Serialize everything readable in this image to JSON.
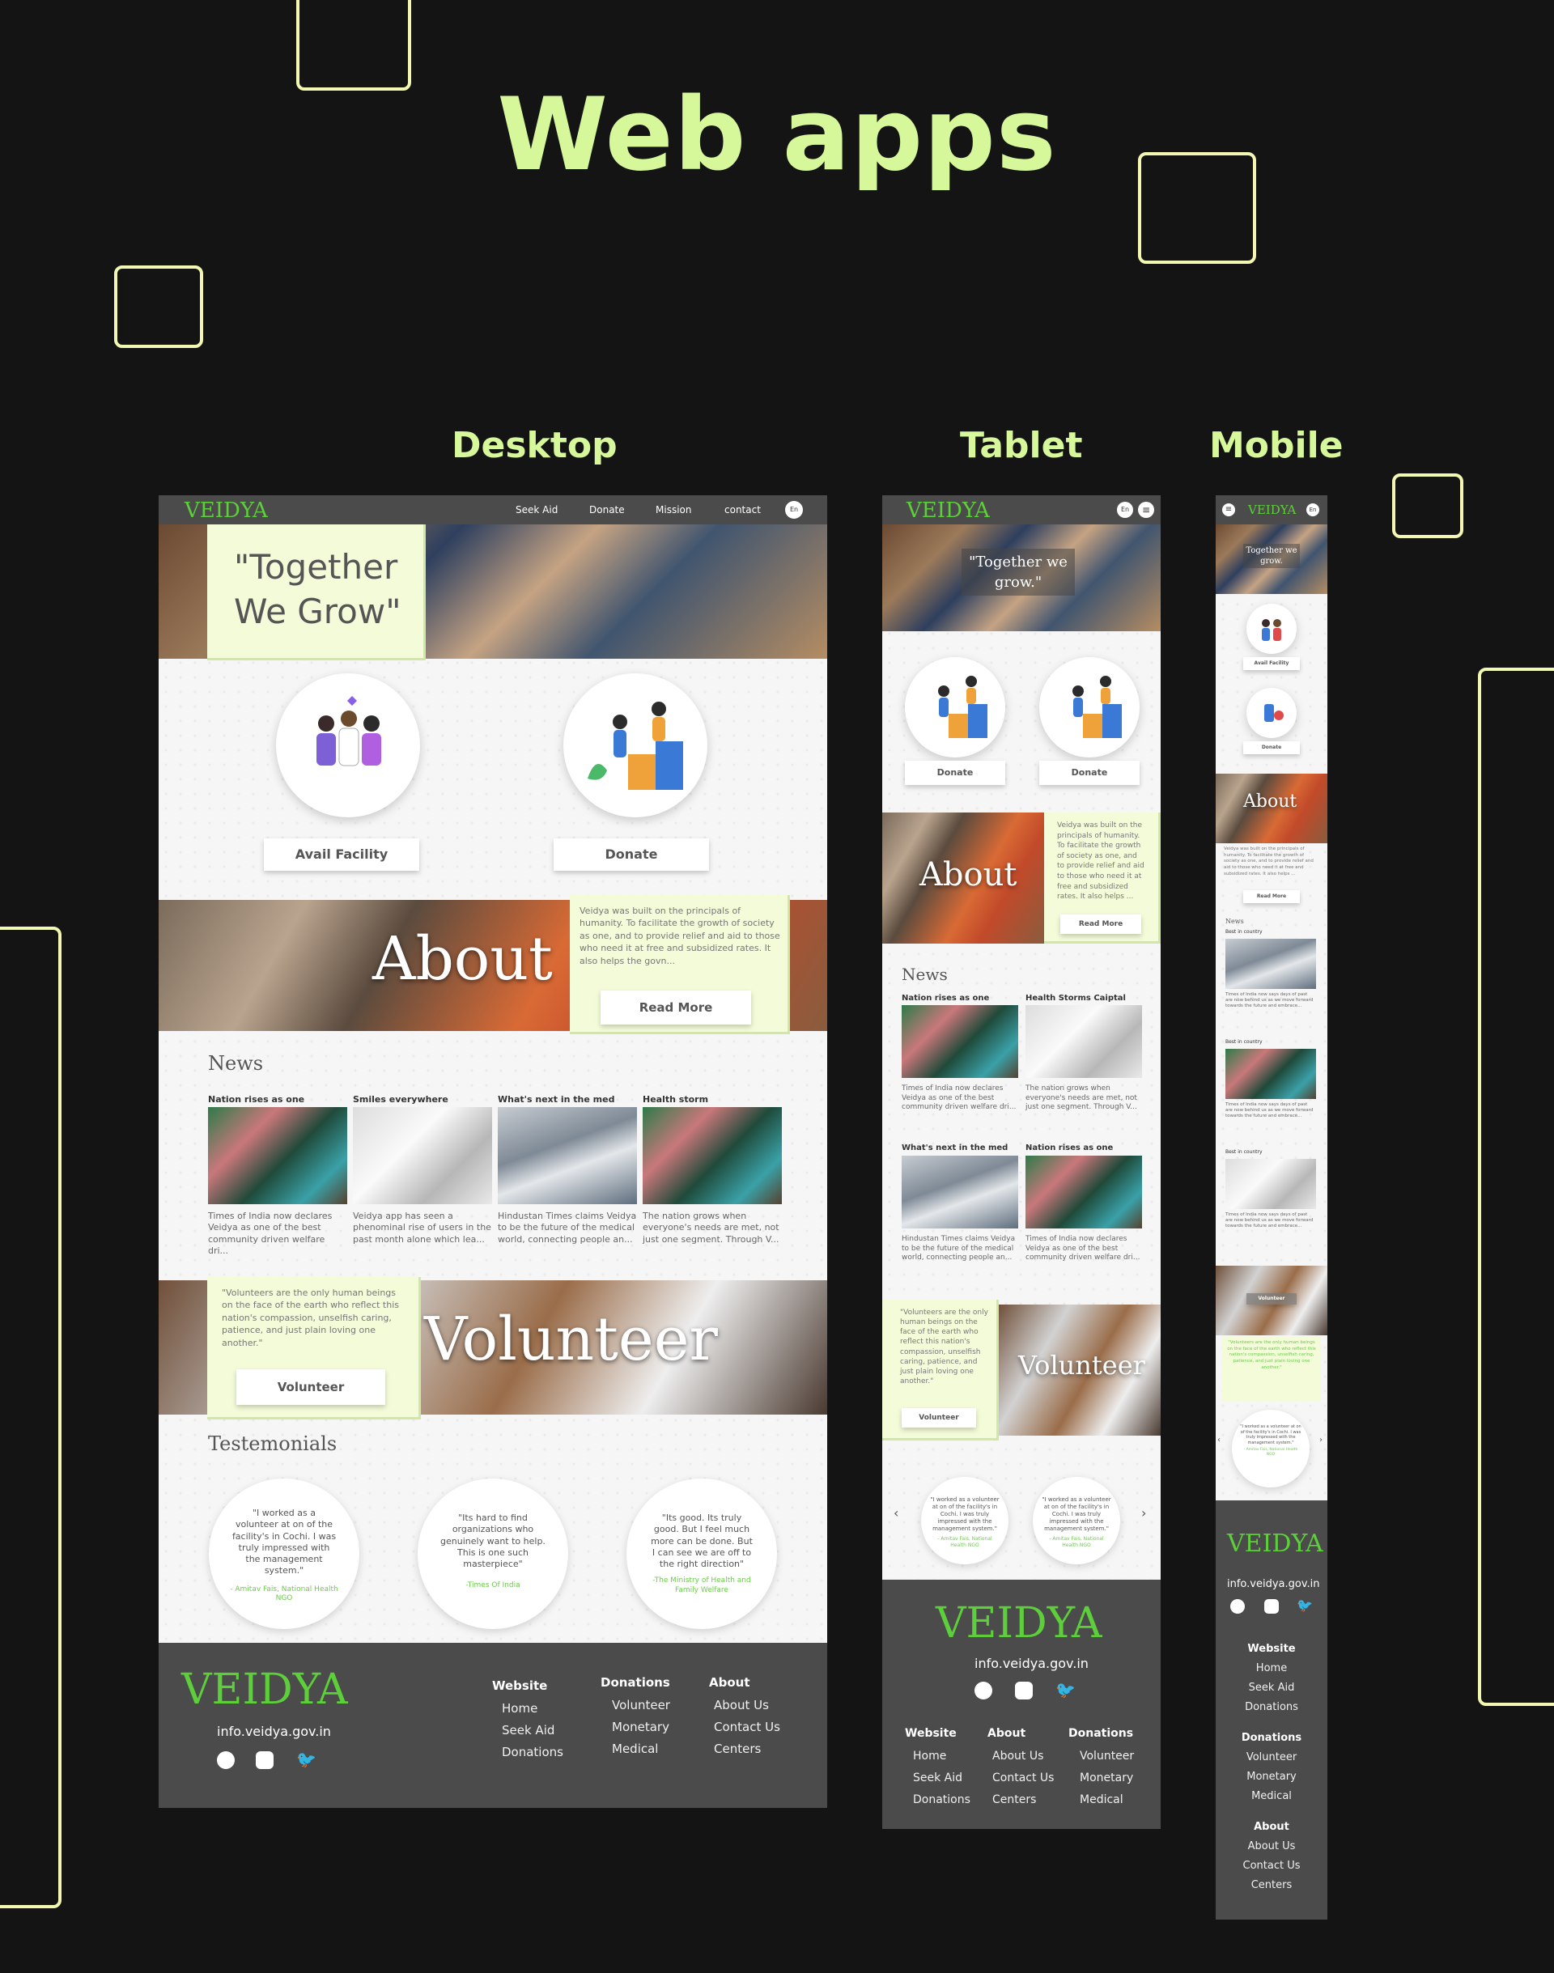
{
  "page_title": "Web apps",
  "labels": {
    "desktop": "Desktop",
    "tablet": "Tablet",
    "mobile": "Mobile"
  },
  "brand": {
    "logo": "VEIDYA",
    "email": "info.veidya.gov.in",
    "lang": "En"
  },
  "nav": {
    "seek_aid": "Seek Aid",
    "donate": "Donate",
    "mission": "Mission",
    "contact": "contact"
  },
  "hero": {
    "desktop_quote": "\"Together We Grow\"",
    "tablet_quote": "\"Together we grow.\"",
    "mobile_quote": "Together we grow."
  },
  "actions": {
    "avail": "Avail Facility",
    "donate": "Donate"
  },
  "about": {
    "word": "About",
    "desktop_text": "Veidya was built on the principals of humanity. To facilitate the growth of society as one, and to provide relief and aid to those who need it at free and subsidized rates. It also helps the govn...",
    "tablet_text": "Veidya was built on the principals of humanity. To facilitate the growth of society as one, and to provide relief and aid to those who need it at free and subsidized rates. It also helps ...",
    "mobile_text": "Veidya was built on the principals of humanity. To facilitate the growth of society as one, and to provide relief and aid to those who need it at free and subsidized rates. It also helps ...",
    "read_more": "Read More"
  },
  "news": {
    "heading": "News",
    "desktop": [
      {
        "title": "Nation rises as one",
        "text": "Times of India now declares Veidya as one of the best community driven welfare dri..."
      },
      {
        "title": "Smiles everywhere",
        "text": "Veidya app has seen a phenominal rise of users in the past month alone which lea..."
      },
      {
        "title": "What's next in the med",
        "text": "Hindustan Times claims Veidya to be the future of the medical world, connecting people an..."
      },
      {
        "title": "Health storm",
        "text": "The nation grows when everyone's needs are met, not just one segment. Through V..."
      }
    ],
    "tablet": [
      {
        "title": "Nation rises as one",
        "text": "Times of India now declares Veidya as one of the best community driven welfare dri..."
      },
      {
        "title": "Health Storms Caiptal",
        "text": "The nation grows when everyone's needs are met, not just one segment. Through V..."
      },
      {
        "title": "What's next in the med",
        "text": "Hindustan Times claims Veidya to be the future of the medical world, connecting people an..."
      },
      {
        "title": "Nation rises as one",
        "text": "Times of India now declares Veidya as one of the best community driven welfare dri..."
      }
    ],
    "mobile_label": "Best in country",
    "mobile_text": "Times of India now says days of past are now behind us as we move forward towards the future and embrace..."
  },
  "volunteer": {
    "word": "Volunteer",
    "quote": "\"Volunteers are the only human beings on the face of the earth who reflect this nation's compassion, unselfish caring, patience, and just plain loving one another.\"",
    "button": "Volunteer"
  },
  "testimonials": {
    "heading": "Testemonials",
    "items": [
      {
        "text": "\"I worked as a volunteer at on of the facility's in Cochi. I was truly impressed with the management system.\"",
        "source": "- Amitav Fais, National Health NGO"
      },
      {
        "text": "\"Its hard to find organizations who genuinely want to help. This is one such masterpiece\"",
        "source": "-Times Of India"
      },
      {
        "text": "\"Its good. Its truly good. But I feel much more can be done. But I can see we are off to the right direction\"",
        "source": "-The Ministry of Health and Family Welfare"
      }
    ]
  },
  "footer": {
    "website": {
      "title": "Website",
      "links": [
        "Home",
        "Seek Aid",
        "Donations"
      ]
    },
    "donations": {
      "title": "Donations",
      "links": [
        "Volunteer",
        "Monetary",
        "Medical"
      ]
    },
    "about": {
      "title": "About",
      "links": [
        "About Us",
        "Contact Us",
        "Centers"
      ]
    }
  },
  "colors": {
    "background": "#141414",
    "accent": "#d6f79a",
    "outline": "#f2f7b2",
    "logo_green": "#5ccf3a",
    "nav_gray": "#4b4b4b",
    "pale_green": "#f3fbd9"
  }
}
